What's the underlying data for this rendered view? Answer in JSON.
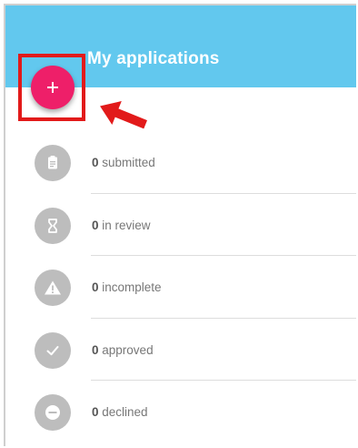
{
  "header": {
    "title": "My applications",
    "background_color": "#62c8ee"
  },
  "add_button": {
    "icon": "plus-icon",
    "color": "#ee1f69"
  },
  "annotation": {
    "highlight_color": "#e21a1a",
    "arrow_icon": "arrow-pointer-icon"
  },
  "statuses": [
    {
      "count": "0",
      "label": "submitted",
      "icon": "clipboard-icon"
    },
    {
      "count": "0",
      "label": "in review",
      "icon": "hourglass-icon"
    },
    {
      "count": "0",
      "label": "incomplete",
      "icon": "warning-icon"
    },
    {
      "count": "0",
      "label": "approved",
      "icon": "check-icon"
    },
    {
      "count": "0",
      "label": "declined",
      "icon": "minus-circle-icon"
    }
  ]
}
